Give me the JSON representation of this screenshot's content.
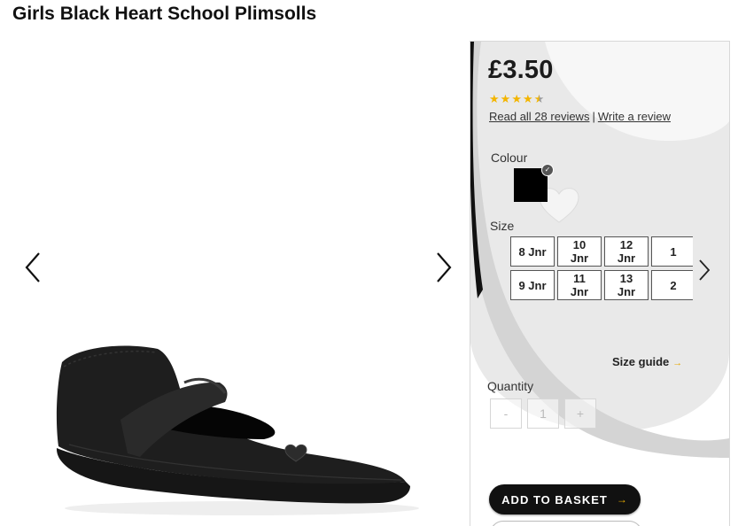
{
  "product": {
    "title": "Girls Black Heart School Plimsolls",
    "price": "£3.50",
    "rating": 4.5,
    "rating_max": 5,
    "reviews_link": "Read all 28 reviews",
    "separator": "|",
    "write_review_link": "Write a review"
  },
  "colour": {
    "label": "Colour",
    "selected_hex": "#000000"
  },
  "size": {
    "label": "Size",
    "options": [
      "8 Jnr",
      "10 Jnr",
      "12 Jnr",
      "1",
      "9 Jnr",
      "11 Jnr",
      "13 Jnr",
      "2"
    ],
    "size_guide": "Size guide"
  },
  "quantity": {
    "label": "Quantity",
    "minus": "-",
    "value": "1",
    "plus": "+"
  },
  "actions": {
    "add_to_basket": "ADD TO BASKET"
  },
  "icons": {
    "prev": "chevron-left-icon",
    "next": "chevron-right-icon",
    "button_arrow": "arrow-right-icon"
  },
  "colors": {
    "accent": "#f2b400",
    "button": "#111111"
  }
}
